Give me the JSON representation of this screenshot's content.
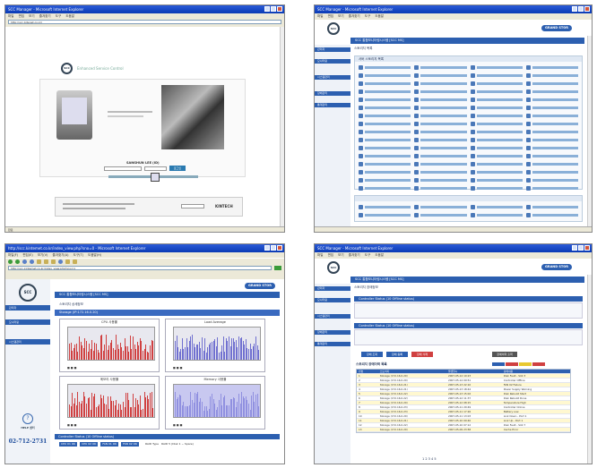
{
  "shot1": {
    "window_title": "SCC Manager - Microsoft Internet Explorer",
    "menu": [
      "파일",
      "편집",
      "보기",
      "즐겨찾기",
      "도구",
      "도움말"
    ],
    "address": "http://scc.bitenet.co.kr/",
    "logo_text": "SCC",
    "login_title": "Enhanced Service Control",
    "login_heading": "SANGHUN LEE (ID)",
    "login_button": "로그인",
    "footer_brand": "KINTECH",
    "status": "완료"
  },
  "shot2": {
    "window_title": "SCC Manager - Microsoft Internet Explorer",
    "menu": [
      "파일",
      "편집",
      "보기",
      "즐겨찾기",
      "도구",
      "도움말"
    ],
    "logo_text": "SCC",
    "grand_label": "GRAND STOR",
    "header_bar": "SCC 통합모니터링시스템 [SCC MS]",
    "sub_bar": "스토리지 목록",
    "sidebar": [
      "관리자",
      "모니터링",
      "시스템관리",
      "장애관리",
      "통계관리"
    ],
    "section_label": "서버 스토리지 목록"
  },
  "shot3": {
    "window_title": "http://scc.kintemet.co.kr/index_view.php?sno=0 - Microsoft Internet Explorer",
    "menu": [
      "파일(F)",
      "편집(E)",
      "보기(V)",
      "즐겨찾기(A)",
      "도구(T)",
      "도움말(H)"
    ],
    "address": "http://scc.kintemet.co.kr/index_view.php?sno=1",
    "logo_text": "SCC",
    "grand_label": "GRAND STOR",
    "header_bar": "SCC 통합모니터링시스템 [SCC MS]",
    "page_label": "스토리지 상세정보",
    "sidebar": [
      "관리자",
      "모니터링",
      "시스템관리",
      "장애관리",
      "통계관리"
    ],
    "storage_label": "Storage (IP:172.16.0.20)",
    "chart_titles": [
      "CPU 사용률",
      "Load Average",
      "메모리 사용률",
      "Memory 사용률"
    ],
    "help_label": "HELP 센터",
    "phone": "02-712-2731",
    "controller_label": "Controller Status (10 Offline status)",
    "controller_cells": [
      "CPU 01 OK",
      "CPU 02 OK",
      "FAN 01 OK",
      "FAN 02 OK"
    ],
    "raid_label": "RAID Type",
    "raid_value": "RAID 5 (Disk 1 ~ Spare)"
  },
  "shot4": {
    "window_title": "SCC Manager - Microsoft Internet Explorer",
    "menu": [
      "파일",
      "편집",
      "보기",
      "즐겨찾기",
      "도구",
      "도움말"
    ],
    "logo_text": "SCC",
    "grand_label": "GRAND STOR",
    "header_bar": "SCC 통합모니터링시스템 [SCC MS]",
    "sub_bar": "스토리지 장애정보",
    "section1": "Controller Status (10 Offline status)",
    "section2": "Controller Status (10 Offline status)",
    "buttons": [
      "장애 조회",
      "장애 등록",
      "장애 삭제",
      "장애이력 출력"
    ],
    "table_label": "스토리지 장애이력 목록",
    "table_headers": [
      "번호",
      "스토리지",
      "발생일시",
      "장애내용"
    ],
    "table_rows": [
      [
        "1",
        "Storage (172.16.0.20)",
        "2007-05-14 10:23",
        "Disk Fault - Slot 3"
      ],
      [
        "2",
        "Storage (172.16.0.20)",
        "2007-05-14 09:51",
        "Controller Offline"
      ],
      [
        "3",
        "Storage (172.16.0.21)",
        "2007-05-13 22:10",
        "FAN 02 Failure"
      ],
      [
        "4",
        "Storage (172.16.0.21)",
        "2007-05-13 18:44",
        "Power Supply Warning"
      ],
      [
        "5",
        "Storage (172.16.0.22)",
        "2007-05-13 15:02",
        "Disk Rebuild Start"
      ],
      [
        "6",
        "Storage (172.16.0.22)",
        "2007-05-12 11:37",
        "Disk Rebuild Done"
      ],
      [
        "7",
        "Storage (172.16.0.20)",
        "2007-05-12 08:15",
        "Temperature High"
      ],
      [
        "8",
        "Storage (172.16.0.23)",
        "2007-05-11 20:49",
        "Controller Online"
      ],
      [
        "9",
        "Storage (172.16.0.23)",
        "2007-05-11 17:26",
        "Battery Low"
      ],
      [
        "10",
        "Storage (172.16.0.20)",
        "2007-05-11 13:03",
        "Link Down - Port 1"
      ],
      [
        "11",
        "Storage (172.16.0.21)",
        "2007-05-10 09:40",
        "Link Up - Port 1"
      ],
      [
        "12",
        "Storage (172.16.0.22)",
        "2007-05-10 07:12",
        "Disk Fault - Slot 7"
      ],
      [
        "13",
        "Storage (172.16.0.20)",
        "2007-05-09 23:58",
        "Cache Error"
      ]
    ],
    "pager": "1 2 3 4 5"
  }
}
